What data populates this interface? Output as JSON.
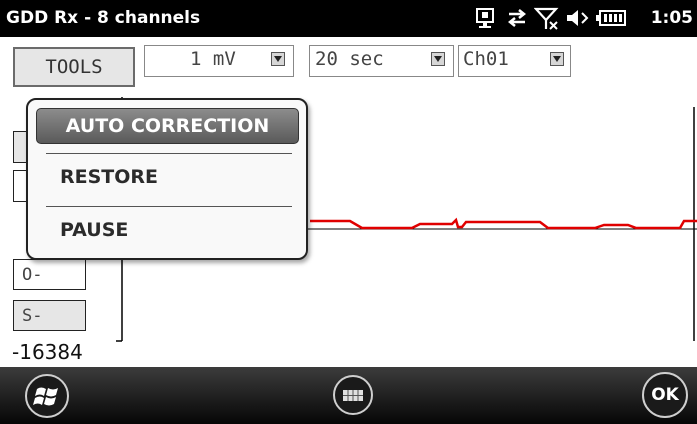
{
  "titlebar": {
    "title": "GDD Rx - 8 channels",
    "clock": "1:05",
    "icons": [
      "sync-icon",
      "connectivity-icon",
      "no-signal-icon",
      "volume-icon",
      "battery-icon"
    ]
  },
  "toolbar": {
    "tools_label": "TOOLS",
    "sensitivity_value": "1 mV",
    "timebase_value": "20 sec",
    "channel_value": "Ch01"
  },
  "side_buttons": {
    "offset_minus": "O-",
    "scale_minus": "S-"
  },
  "plot": {
    "y_min_label": "-16384",
    "trace_color": "#e00000"
  },
  "popup_menu": {
    "items": [
      "AUTO CORRECTION",
      "RESTORE",
      "PAUSE"
    ]
  },
  "bottombar": {
    "start_icon": "windows-start-icon",
    "keyboard_icon": "keyboard-icon",
    "ok_label": "OK"
  }
}
